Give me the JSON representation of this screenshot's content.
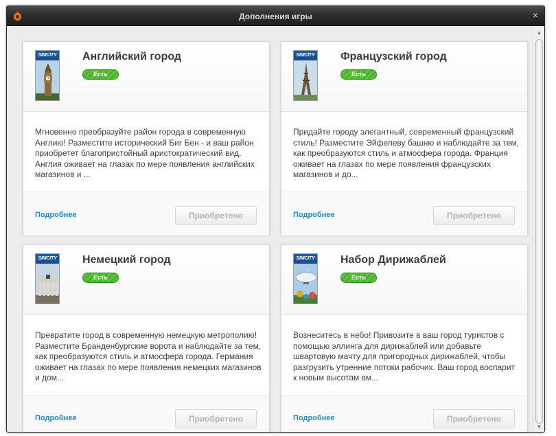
{
  "window": {
    "title": "Дополнения игры",
    "close_symbol": "×",
    "accent_color": "#f26b1d"
  },
  "cards": [
    {
      "name": "Английский город",
      "brand": "SIMCITY",
      "badge": "Есть",
      "cover_icon": "big-ben",
      "description": "Мгновенно преобразуйте район города в современную Англию! Разместите исторический Биг Бен - и ваш район приобретет благопристойный аристократический вид. Англия оживает на глазах по мере появления английских магазинов и ...",
      "more_label": "Подробнее",
      "button_label": "Приобретено"
    },
    {
      "name": "Французский город",
      "brand": "SIMCITY",
      "badge": "Есть",
      "cover_icon": "eiffel-tower",
      "description": "Придайте городу элегантный, современный французский стиль! Разместите Эйфелеву башню и наблюдайте за тем, как преобразуются стиль и атмосфера города. Франция оживает на глазах по мере появления французских магазинов и до...",
      "more_label": "Подробнее",
      "button_label": "Приобретено"
    },
    {
      "name": "Немецкий город",
      "brand": "SIMCITY",
      "badge": "Есть",
      "cover_icon": "brandenburg-gate",
      "description": "Превратите город в современную немецкую метрополию! Разместите Бранденбургские ворота и наблюдайте за тем, как преобразуются стиль и атмосфера города. Германия оживает на глазах по мере появления немецких магазинов и дом...",
      "more_label": "Подробнее",
      "button_label": "Приобретено"
    },
    {
      "name": "Набор Дирижаблей",
      "brand": "SIMCITY",
      "badge": "Есть",
      "cover_icon": "airship",
      "description": "Вознеситесь в небо! Привозите в ваш город туристов с помощью эллинга для дирижаблей или добавьте швартовую мачту для пригородных дирижаблей, чтобы разгрузить утренние потоки рабочих. Ваш город воспарит к новым высотам вм...",
      "more_label": "Подробнее",
      "button_label": "Приобретено"
    }
  ]
}
